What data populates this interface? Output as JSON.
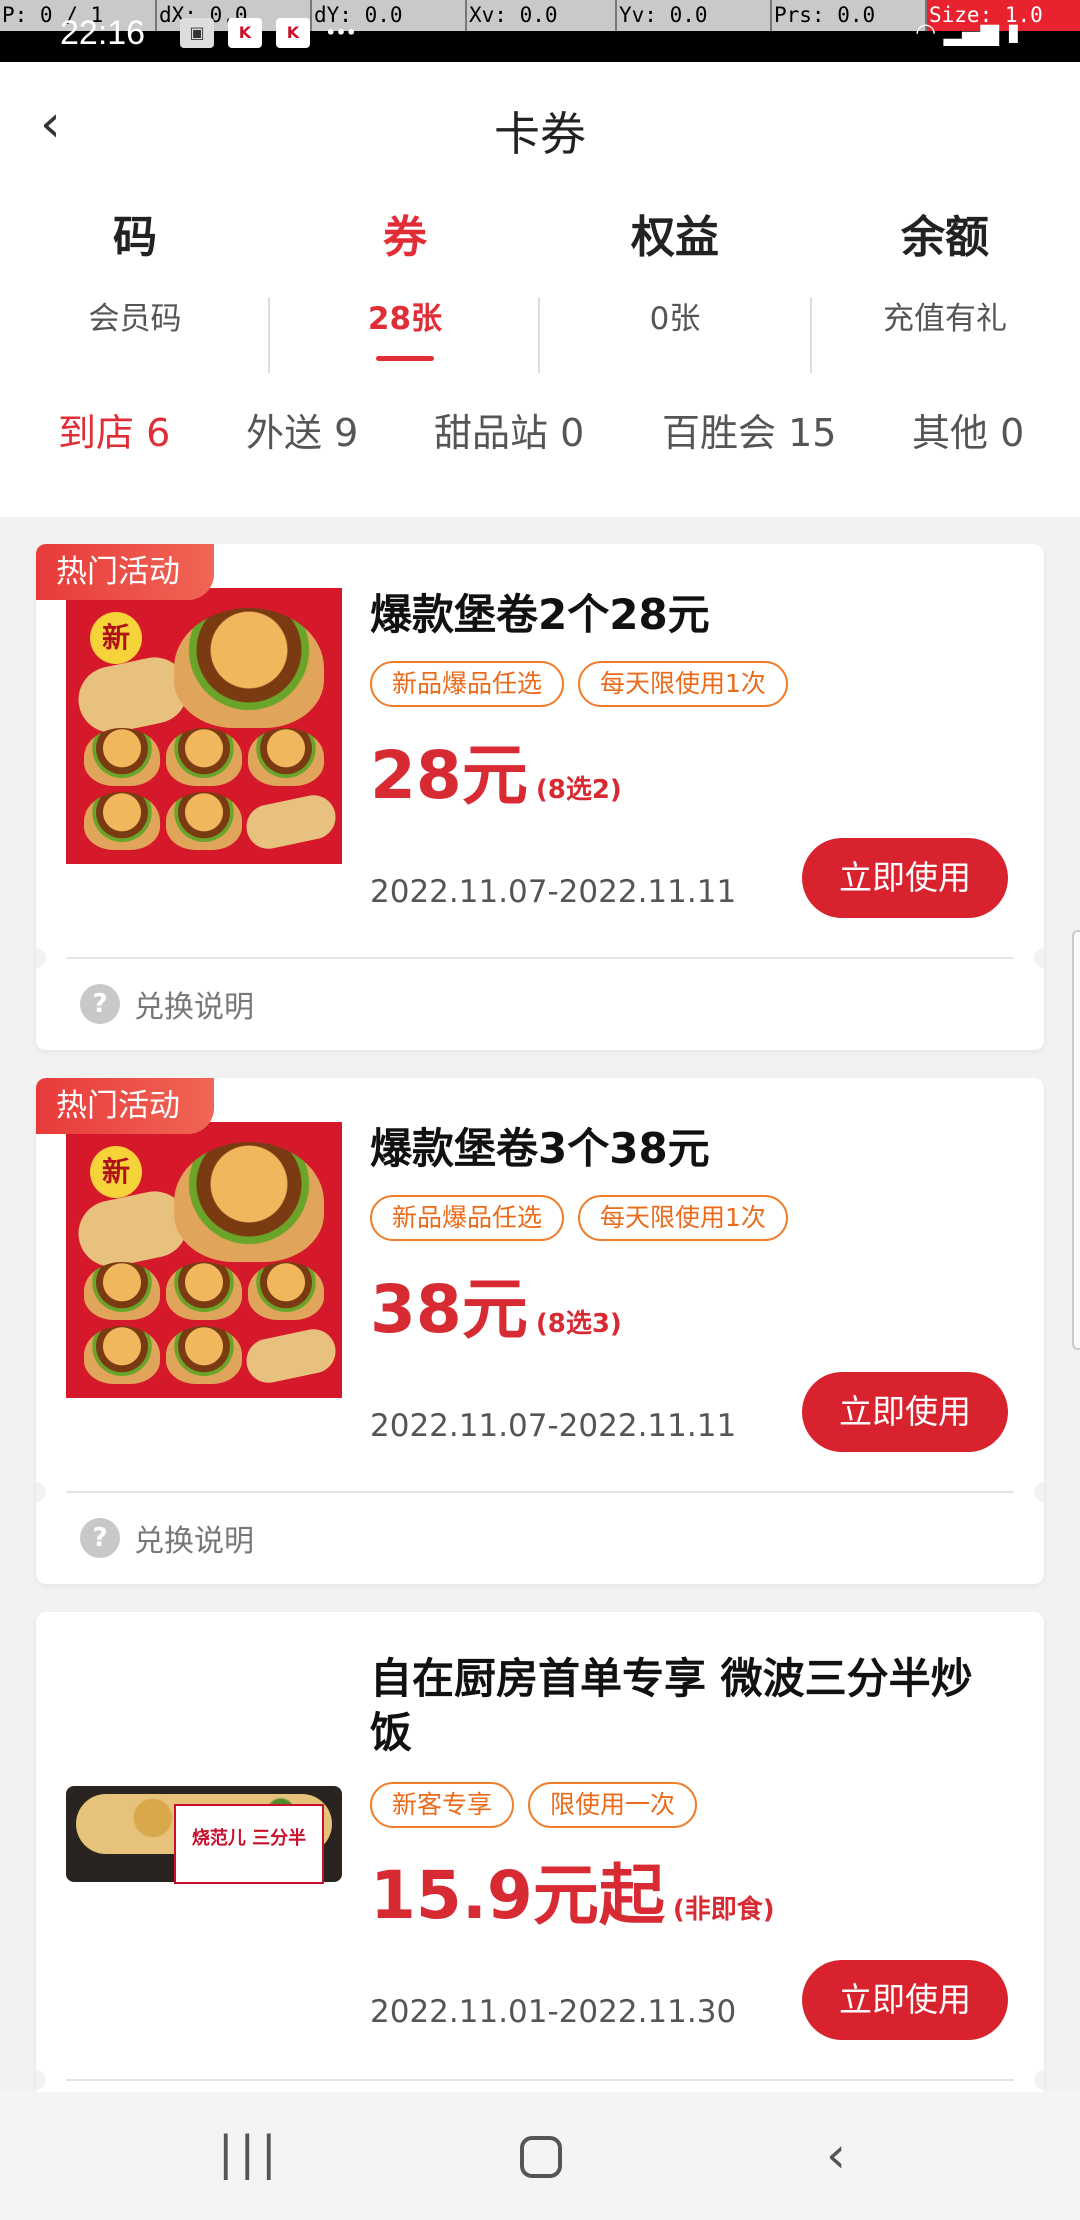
{
  "statusbar": {
    "time": "22:16",
    "debug": {
      "p": "P: 0 / 1",
      "dx": "dX: 0.0",
      "dy": "dY: 0.0",
      "xv": "Xv: 0.0",
      "yv": "Yv: 0.0",
      "prs": "Prs: 0.0",
      "size": "Size: 1.0"
    },
    "icons": [
      "image-icon",
      "kfc-icon",
      "kfc-icon",
      "more-icon"
    ],
    "right_icons": [
      "wifi-icon",
      "signal-icon",
      "battery-icon"
    ]
  },
  "header": {
    "title": "卡券",
    "back_icon": "chevron-left-icon"
  },
  "categories": [
    {
      "big": "码",
      "small": "会员码",
      "active": false
    },
    {
      "big": "券",
      "small": "28张",
      "active": true
    },
    {
      "big": "权益",
      "small": "0张",
      "active": false
    },
    {
      "big": "余额",
      "small": "充值有礼",
      "active": false
    }
  ],
  "subtabs": [
    {
      "label": "到店 6",
      "active": true
    },
    {
      "label": "外送 9",
      "active": false
    },
    {
      "label": "甜品站 0",
      "active": false
    },
    {
      "label": "百胜会 15",
      "active": false
    },
    {
      "label": "其他 0",
      "active": false
    }
  ],
  "coupons": [
    {
      "hot": "热门活动",
      "title": "爆款堡卷2个28元",
      "tags": [
        "新品爆品任选",
        "每天限使用1次"
      ],
      "price": "28元",
      "note": "(8选2)",
      "date": "2022.11.07-2022.11.11",
      "button": "立即使用",
      "explain": "兑换说明",
      "new_badge": "新"
    },
    {
      "hot": "热门活动",
      "title": "爆款堡卷3个38元",
      "tags": [
        "新品爆品任选",
        "每天限使用1次"
      ],
      "price": "38元",
      "note": "(8选3)",
      "date": "2022.11.07-2022.11.11",
      "button": "立即使用",
      "explain": "兑换说明",
      "new_badge": "新"
    },
    {
      "title": "自在厨房首单专享 微波三分半炒饭",
      "tags": [
        "新客专享",
        "限使用一次"
      ],
      "price": "15.9元起",
      "note": "(非即食)",
      "date": "2022.11.01-2022.11.30",
      "button": "立即使用",
      "label": "烧范儿 三分半"
    }
  ],
  "navbar": {
    "recents_icon": "recents-icon",
    "home_icon": "home-icon",
    "back_icon": "back-icon"
  },
  "colors": {
    "accent": "#e02d36",
    "tag_orange": "#f07d2a",
    "button_red": "#d8232f"
  }
}
